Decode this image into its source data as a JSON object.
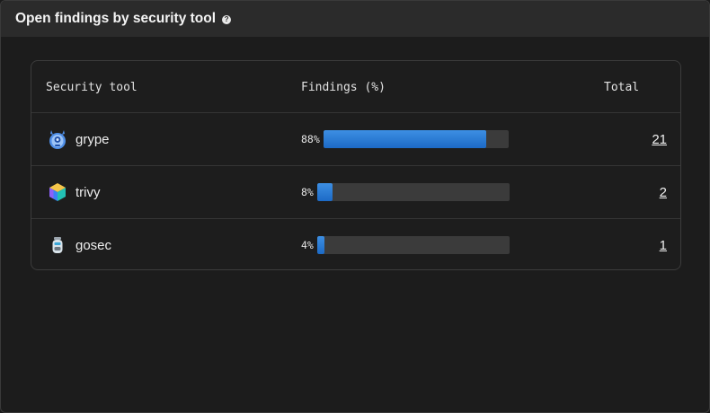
{
  "widget": {
    "title": "Open findings by security tool",
    "help_icon": "question-circle-icon"
  },
  "table": {
    "columns": {
      "tool": "Security tool",
      "findings": "Findings (%)",
      "total": "Total"
    },
    "rows": [
      {
        "tool": "grype",
        "icon": "grype-logo-icon",
        "percent_label": "88%",
        "percent": 88,
        "total": "21"
      },
      {
        "tool": "trivy",
        "icon": "trivy-logo-icon",
        "percent_label": "8%",
        "percent": 8,
        "total": "2"
      },
      {
        "tool": "gosec",
        "icon": "gosec-logo-icon",
        "percent_label": "4%",
        "percent": 4,
        "total": "1"
      }
    ]
  },
  "colors": {
    "bar_fill": "#2a7bd6",
    "bar_track": "#3b3b3b",
    "header_bg": "#2b2b2b",
    "panel_bg": "#1c1c1c"
  }
}
